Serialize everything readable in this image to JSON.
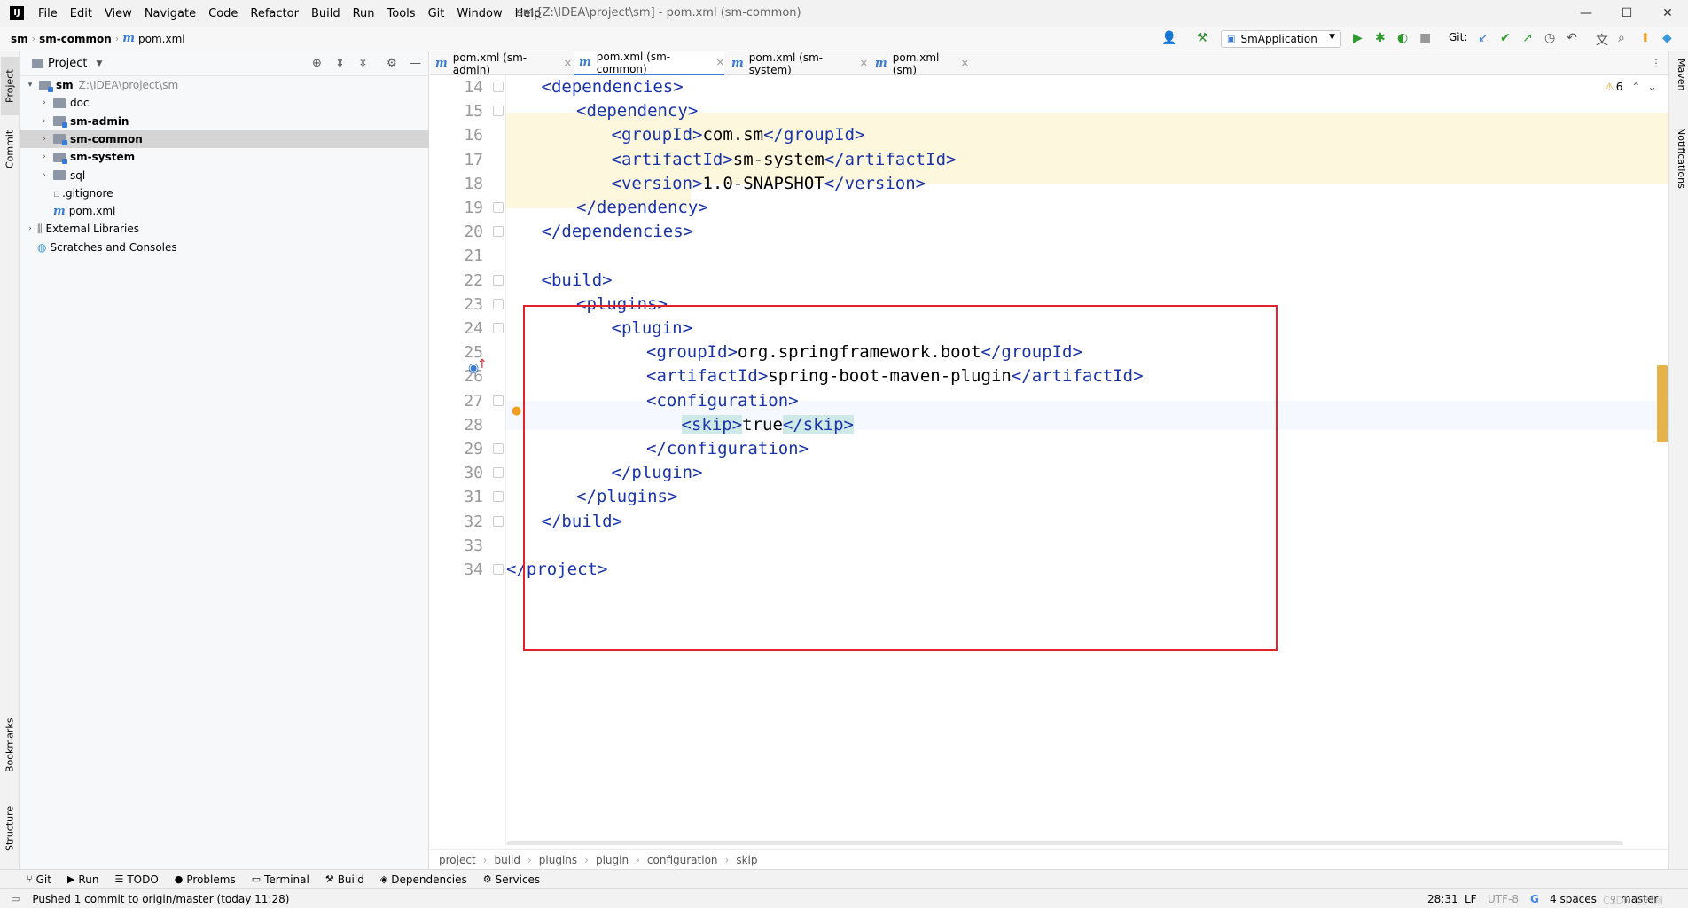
{
  "window": {
    "title": "sm [Z:\\IDEA\\project\\sm] - pom.xml (sm-common)",
    "logo": "IJ",
    "minimize": "—",
    "maximize": "☐",
    "close": "✕"
  },
  "menu": [
    "File",
    "Edit",
    "View",
    "Navigate",
    "Code",
    "Refactor",
    "Build",
    "Run",
    "Tools",
    "Git",
    "Window",
    "Help"
  ],
  "nav": {
    "crumbs": [
      "sm",
      "sm-common",
      "pom.xml"
    ],
    "run_config": "SmApplication",
    "git_label": "Git:"
  },
  "left_strip": [
    "Project",
    "Commit",
    "Bookmarks",
    "Structure"
  ],
  "right_strip": [
    "Maven",
    "Notifications"
  ],
  "project": {
    "title": "Project",
    "tree": [
      {
        "label": "sm",
        "path": "Z:\\IDEA\\project\\sm",
        "bold": true,
        "expanded": true,
        "indent": 0,
        "kind": "module"
      },
      {
        "label": "doc",
        "indent": 1,
        "kind": "folder"
      },
      {
        "label": "sm-admin",
        "indent": 1,
        "kind": "module",
        "bold": true
      },
      {
        "label": "sm-common",
        "indent": 1,
        "kind": "module",
        "bold": true,
        "selected": true
      },
      {
        "label": "sm-system",
        "indent": 1,
        "kind": "module",
        "bold": true
      },
      {
        "label": "sql",
        "indent": 1,
        "kind": "folder"
      },
      {
        "label": ".gitignore",
        "indent": 1,
        "kind": "file"
      },
      {
        "label": "pom.xml",
        "indent": 1,
        "kind": "maven"
      },
      {
        "label": "External Libraries",
        "indent": 0,
        "kind": "lib"
      },
      {
        "label": "Scratches and Consoles",
        "indent": 0,
        "kind": "scratch"
      }
    ]
  },
  "tabs": [
    {
      "label": "pom.xml (sm-admin)",
      "active": false
    },
    {
      "label": "pom.xml (sm-common)",
      "active": true
    },
    {
      "label": "pom.xml (sm-system)",
      "active": false
    },
    {
      "label": "pom.xml (sm)",
      "active": false
    }
  ],
  "editor": {
    "warning_count": "6",
    "lines": [
      {
        "n": "14",
        "indent": 1,
        "parts": [
          {
            "t": "tag",
            "v": "<dependencies>"
          }
        ]
      },
      {
        "n": "15",
        "indent": 2,
        "parts": [
          {
            "t": "tag",
            "v": "<dependency>"
          }
        ]
      },
      {
        "n": "16",
        "indent": 3,
        "parts": [
          {
            "t": "tag",
            "v": "<groupId>"
          },
          {
            "t": "txt",
            "v": "com.sm"
          },
          {
            "t": "tag",
            "v": "</groupId>"
          }
        ]
      },
      {
        "n": "17",
        "indent": 3,
        "parts": [
          {
            "t": "tag",
            "v": "<artifactId>"
          },
          {
            "t": "txt",
            "v": "sm-system"
          },
          {
            "t": "tag",
            "v": "</artifactId>"
          }
        ]
      },
      {
        "n": "18",
        "indent": 3,
        "parts": [
          {
            "t": "tag",
            "v": "<version>"
          },
          {
            "t": "txt",
            "v": "1.0-SNAPSHOT"
          },
          {
            "t": "tag",
            "v": "</version>"
          }
        ]
      },
      {
        "n": "19",
        "indent": 2,
        "parts": [
          {
            "t": "tag",
            "v": "</dependency>"
          }
        ]
      },
      {
        "n": "20",
        "indent": 1,
        "parts": [
          {
            "t": "tag",
            "v": "</dependencies>"
          }
        ]
      },
      {
        "n": "21",
        "indent": 0,
        "parts": []
      },
      {
        "n": "22",
        "indent": 1,
        "parts": [
          {
            "t": "tag",
            "v": "<build>"
          }
        ]
      },
      {
        "n": "23",
        "indent": 2,
        "parts": [
          {
            "t": "tag",
            "v": "<plugins>"
          }
        ]
      },
      {
        "n": "24",
        "indent": 3,
        "parts": [
          {
            "t": "tag",
            "v": "<plugin>"
          }
        ]
      },
      {
        "n": "25",
        "indent": 4,
        "parts": [
          {
            "t": "tag",
            "v": "<groupId>"
          },
          {
            "t": "txt",
            "v": "org.springframework.boot"
          },
          {
            "t": "tag",
            "v": "</groupId>"
          }
        ]
      },
      {
        "n": "26",
        "indent": 4,
        "parts": [
          {
            "t": "tag",
            "v": "<artifactId>"
          },
          {
            "t": "txt",
            "v": "spring-boot-maven-plugin"
          },
          {
            "t": "tag",
            "v": "</artifactId>"
          }
        ]
      },
      {
        "n": "27",
        "indent": 4,
        "parts": [
          {
            "t": "tag",
            "v": "<configuration>"
          }
        ]
      },
      {
        "n": "28",
        "indent": 5,
        "parts": [
          {
            "t": "tag-hl",
            "v": "<skip>"
          },
          {
            "t": "txt",
            "v": "true"
          },
          {
            "t": "tag-hl",
            "v": "</skip>"
          }
        ]
      },
      {
        "n": "29",
        "indent": 4,
        "parts": [
          {
            "t": "tag",
            "v": "</configuration>"
          }
        ]
      },
      {
        "n": "30",
        "indent": 3,
        "parts": [
          {
            "t": "tag",
            "v": "</plugin>"
          }
        ]
      },
      {
        "n": "31",
        "indent": 2,
        "parts": [
          {
            "t": "tag",
            "v": "</plugins>"
          }
        ]
      },
      {
        "n": "32",
        "indent": 1,
        "parts": [
          {
            "t": "tag",
            "v": "</build>"
          }
        ]
      },
      {
        "n": "33",
        "indent": 0,
        "parts": []
      },
      {
        "n": "34",
        "indent": 0,
        "parts": [
          {
            "t": "tag",
            "v": "</project>"
          }
        ]
      }
    ]
  },
  "breadcrumb": [
    "project",
    "build",
    "plugins",
    "plugin",
    "configuration",
    "skip"
  ],
  "bottom_tools": [
    {
      "icon": "git-icon",
      "glyph": "⑂",
      "label": "Git"
    },
    {
      "icon": "run-icon",
      "glyph": "▶",
      "label": "Run"
    },
    {
      "icon": "todo-icon",
      "glyph": "☰",
      "label": "TODO"
    },
    {
      "icon": "problems-icon",
      "glyph": "●",
      "label": "Problems"
    },
    {
      "icon": "terminal-icon",
      "glyph": "▭",
      "label": "Terminal"
    },
    {
      "icon": "build-icon",
      "glyph": "⚒",
      "label": "Build"
    },
    {
      "icon": "dependencies-icon",
      "glyph": "◈",
      "label": "Dependencies"
    },
    {
      "icon": "services-icon",
      "glyph": "⚙",
      "label": "Services"
    }
  ],
  "status": {
    "message": "Pushed 1 commit to origin/master (today 11:28)",
    "position": "28:31",
    "line_sep": "LF",
    "encoding": "UTF-8",
    "indent": "4 spaces",
    "branch": "master",
    "watermark": "CSDN @时间"
  }
}
